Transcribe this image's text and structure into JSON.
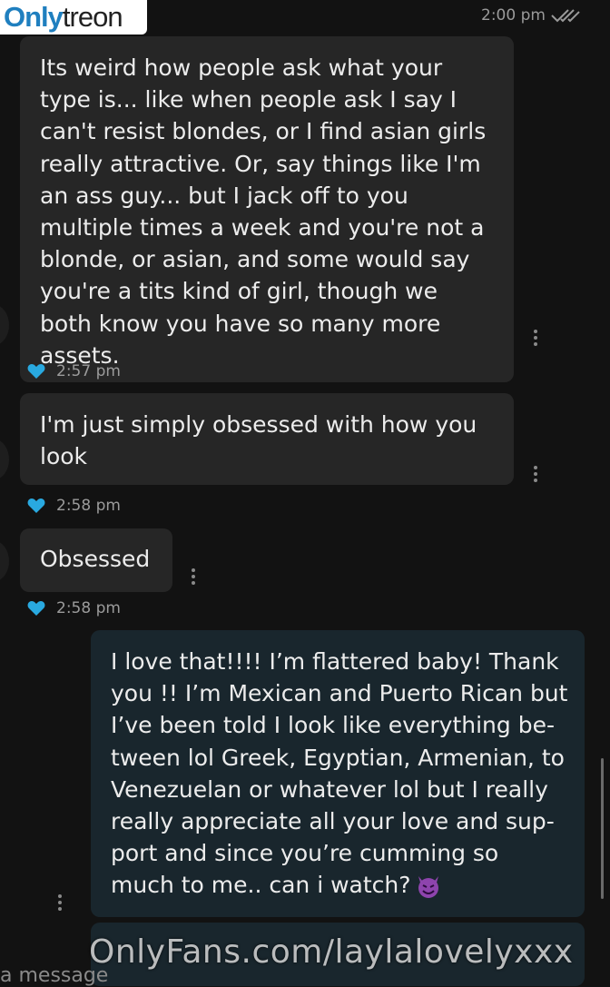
{
  "logo": {
    "part1": "Only",
    "part2": "treon"
  },
  "header": {
    "time": "2:00 pm"
  },
  "messages": [
    {
      "text": "Its weird how people ask what your type is... like when people ask I say I can't resist blondes, or I find asian girls really attractive. Or, say things like I'm an ass guy... but I jack off to you multiple times a week and you're not a blonde, or asian, and some would say you're a tits kind of girl, though we both know you have so many more assets.",
      "time": "2:57 pm"
    },
    {
      "text": "I'm just simply obsessed with how you look",
      "time": "2:58 pm"
    },
    {
      "text": "Obsessed",
      "time": "2:58 pm"
    },
    {
      "text": "I love that!!!! I’m flattered baby! Thank you !! I’m Mexican and Puerto Rican but I’ve been told I look like everything be-tween lol Greek, Egyptian, Armenian, to Venezuelan or whatever lol but I really really appreciate all your love and sup-port and since you’re cumming so much to me.. can i watch?"
    }
  ],
  "input": {
    "placeholder": "a message"
  },
  "watermark": "OnlyFans.com/laylalovelyxxx",
  "icons": {
    "like": "heart-icon",
    "more": "more-vertical-icon",
    "read": "double-check-icon",
    "emoji": "smiling-devil-emoji"
  },
  "colors": {
    "accent": "#29a9e0",
    "bubble_in": "#262626",
    "bubble_out": "#19262d"
  }
}
